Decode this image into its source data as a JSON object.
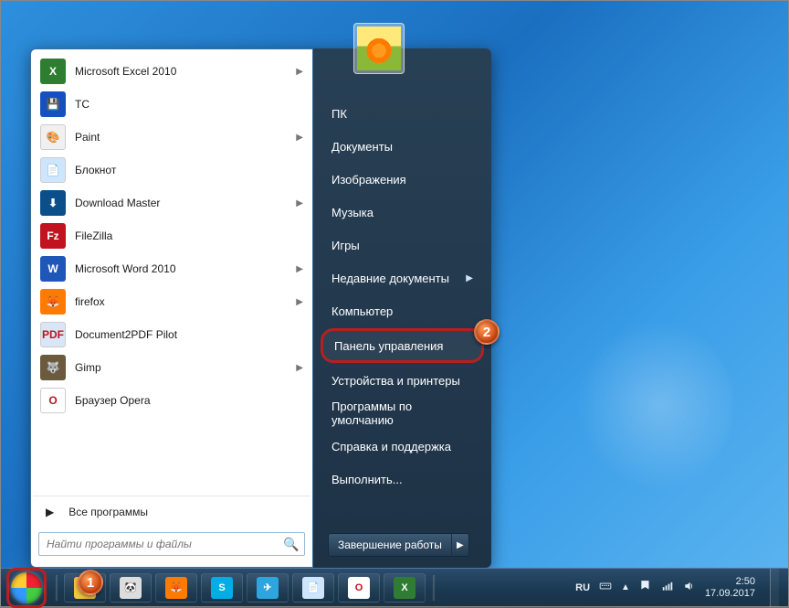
{
  "programs": [
    {
      "label": "Microsoft Excel 2010",
      "flyout": true,
      "ico_bg": "#2f7d32",
      "ico_txt": "X"
    },
    {
      "label": "ТС",
      "flyout": false,
      "ico_bg": "#1550c0",
      "ico_txt": "💾"
    },
    {
      "label": "Paint",
      "flyout": true,
      "ico_bg": "#f0f0f0",
      "ico_txt": "🎨"
    },
    {
      "label": "Блокнот",
      "flyout": false,
      "ico_bg": "#cfe5fb",
      "ico_txt": "📄"
    },
    {
      "label": "Download Master",
      "flyout": true,
      "ico_bg": "#0b4f8a",
      "ico_txt": "⬇"
    },
    {
      "label": "FileZilla",
      "flyout": false,
      "ico_bg": "#c1121f",
      "ico_txt": "Fz"
    },
    {
      "label": "Microsoft Word 2010",
      "flyout": true,
      "ico_bg": "#1e57b8",
      "ico_txt": "W"
    },
    {
      "label": "firefox",
      "flyout": true,
      "ico_bg": "#ff7b00",
      "ico_txt": "🦊"
    },
    {
      "label": "Document2PDF Pilot",
      "flyout": false,
      "ico_bg": "#d8e6f5",
      "ico_txt": "PDF"
    },
    {
      "label": "Gimp",
      "flyout": true,
      "ico_bg": "#6b5a3e",
      "ico_txt": "🐺"
    },
    {
      "label": "Браузер Opera",
      "flyout": false,
      "ico_bg": "#ffffff",
      "ico_txt": "O"
    }
  ],
  "all_programs_label": "Все программы",
  "search_placeholder": "Найти программы и файлы",
  "right_menu": [
    {
      "label": "ПК",
      "flyout": false,
      "highlight": false
    },
    {
      "label": "Документы",
      "flyout": false,
      "highlight": false
    },
    {
      "label": "Изображения",
      "flyout": false,
      "highlight": false
    },
    {
      "label": "Музыка",
      "flyout": false,
      "highlight": false
    },
    {
      "label": "Игры",
      "flyout": false,
      "highlight": false
    },
    {
      "label": "Недавние документы",
      "flyout": true,
      "highlight": false
    },
    {
      "label": "Компьютер",
      "flyout": false,
      "highlight": false
    },
    {
      "label": "Панель управления",
      "flyout": false,
      "highlight": true
    },
    {
      "label": "Устройства и принтеры",
      "flyout": false,
      "highlight": false
    },
    {
      "label": "Программы по умолчанию",
      "flyout": false,
      "highlight": false
    },
    {
      "label": "Справка и поддержка",
      "flyout": false,
      "highlight": false
    },
    {
      "label": "Выполнить...",
      "flyout": false,
      "highlight": false
    }
  ],
  "shutdown_label": "Завершение работы",
  "taskbar": [
    {
      "name": "explorer",
      "bg": "#f5c242",
      "txt": "📁"
    },
    {
      "name": "panda",
      "bg": "#dddddd",
      "txt": "🐼"
    },
    {
      "name": "firefox",
      "bg": "#ff7b00",
      "txt": "🦊"
    },
    {
      "name": "skype",
      "bg": "#00aee6",
      "txt": "S"
    },
    {
      "name": "telegram",
      "bg": "#2da5df",
      "txt": "✈"
    },
    {
      "name": "notepad",
      "bg": "#cfe5fb",
      "txt": "📄"
    },
    {
      "name": "opera",
      "bg": "#ffffff",
      "txt": "O"
    },
    {
      "name": "excel",
      "bg": "#2f7d32",
      "txt": "X"
    }
  ],
  "tray": {
    "lang": "RU",
    "time": "2:50",
    "date": "17.09.2017"
  },
  "callouts": {
    "start": "1",
    "control_panel": "2"
  }
}
